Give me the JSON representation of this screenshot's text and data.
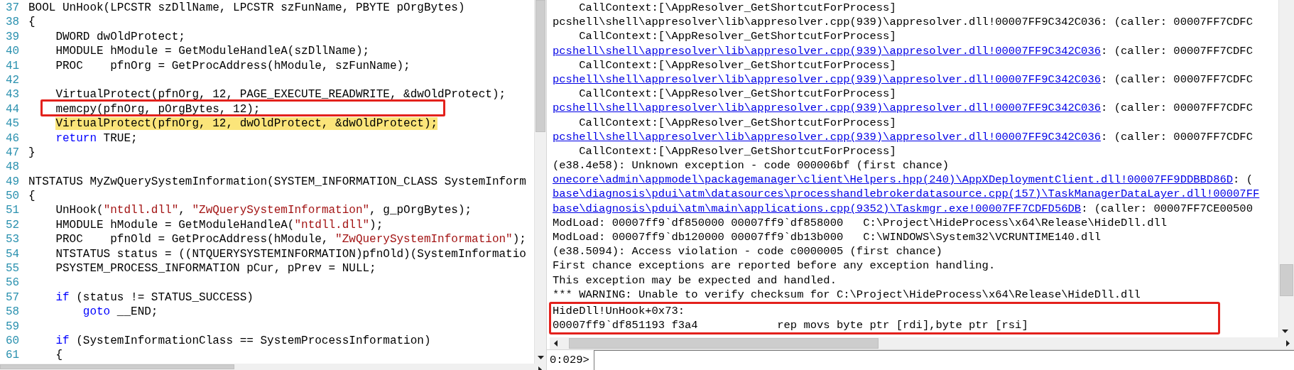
{
  "code_editor": {
    "lines": [
      {
        "number": "37",
        "highlighted": false,
        "boxed": false,
        "tokens": [
          {
            "kind": "plain",
            "text": "BOOL UnHook(LPCSTR szDllName, LPCSTR szFunName, PBYTE pOrgBytes)"
          }
        ]
      },
      {
        "number": "38",
        "highlighted": false,
        "boxed": false,
        "tokens": [
          {
            "kind": "plain",
            "text": "{"
          }
        ]
      },
      {
        "number": "39",
        "highlighted": false,
        "boxed": false,
        "tokens": [
          {
            "kind": "plain",
            "text": "    DWORD dwOldProtect;"
          }
        ]
      },
      {
        "number": "40",
        "highlighted": false,
        "boxed": false,
        "tokens": [
          {
            "kind": "plain",
            "text": "    HMODULE hModule = GetModuleHandleA(szDllName);"
          }
        ]
      },
      {
        "number": "41",
        "highlighted": false,
        "boxed": false,
        "tokens": [
          {
            "kind": "plain",
            "text": "    PROC    pfnOrg = GetProcAddress(hModule, szFunName);"
          }
        ]
      },
      {
        "number": "42",
        "highlighted": false,
        "boxed": false
      },
      {
        "number": "43",
        "highlighted": false,
        "boxed": false,
        "tokens": [
          {
            "kind": "plain",
            "text": "    VirtualProtect(pfnOrg, 12, PAGE_EXECUTE_READWRITE, &dwOldProtect);"
          }
        ]
      },
      {
        "number": "44",
        "highlighted": false,
        "boxed": true,
        "tokens": [
          {
            "kind": "plain",
            "text": "    memcpy(pfnOrg, pOrgBytes, 12);"
          }
        ]
      },
      {
        "number": "45",
        "highlighted": true,
        "boxed": false,
        "tokens": [
          {
            "kind": "plain",
            "text": "    VirtualProtect(pfnOrg, 12, dwOldProtect, &dwOldProtect);"
          }
        ]
      },
      {
        "number": "46",
        "highlighted": false,
        "boxed": false,
        "tokens": [
          {
            "kind": "keyword",
            "text": "    return"
          },
          {
            "kind": "plain",
            "text": " TRUE;"
          }
        ]
      },
      {
        "number": "47",
        "highlighted": false,
        "boxed": false,
        "tokens": [
          {
            "kind": "plain",
            "text": "}"
          }
        ]
      },
      {
        "number": "48",
        "highlighted": false,
        "boxed": false
      },
      {
        "number": "49",
        "highlighted": false,
        "boxed": false,
        "tokens": [
          {
            "kind": "plain",
            "text": "NTSTATUS MyZwQuerySystemInformation(SYSTEM_INFORMATION_CLASS SystemInform"
          }
        ]
      },
      {
        "number": "50",
        "highlighted": false,
        "boxed": false,
        "tokens": [
          {
            "kind": "plain",
            "text": "{"
          }
        ]
      },
      {
        "number": "51",
        "highlighted": false,
        "boxed": false,
        "tokens": [
          {
            "kind": "plain",
            "text": "    UnHook("
          },
          {
            "kind": "string",
            "text": "\"ntdll.dll\""
          },
          {
            "kind": "plain",
            "text": ", "
          },
          {
            "kind": "string",
            "text": "\"ZwQuerySystemInformation\""
          },
          {
            "kind": "plain",
            "text": ", g_pOrgBytes);"
          }
        ]
      },
      {
        "number": "52",
        "highlighted": false,
        "boxed": false,
        "tokens": [
          {
            "kind": "plain",
            "text": "    HMODULE hModule = GetModuleHandleA("
          },
          {
            "kind": "string",
            "text": "\"ntdll.dll\""
          },
          {
            "kind": "plain",
            "text": ");"
          }
        ]
      },
      {
        "number": "53",
        "highlighted": false,
        "boxed": false,
        "tokens": [
          {
            "kind": "plain",
            "text": "    PROC    pfnOld = GetProcAddress(hModule, "
          },
          {
            "kind": "string",
            "text": "\"ZwQuerySystemInformation\""
          },
          {
            "kind": "plain",
            "text": ");"
          }
        ]
      },
      {
        "number": "54",
        "highlighted": false,
        "boxed": false,
        "tokens": [
          {
            "kind": "plain",
            "text": "    NTSTATUS status = ((NTQUERYSYSTEMINFORMATION)pfnOld)(SystemInformatio"
          }
        ]
      },
      {
        "number": "55",
        "highlighted": false,
        "boxed": false,
        "tokens": [
          {
            "kind": "plain",
            "text": "    PSYSTEM_PROCESS_INFORMATION pCur, pPrev = NULL;"
          }
        ]
      },
      {
        "number": "56",
        "highlighted": false,
        "boxed": false
      },
      {
        "number": "57",
        "highlighted": false,
        "boxed": false,
        "tokens": [
          {
            "kind": "keyword",
            "text": "    if"
          },
          {
            "kind": "plain",
            "text": " (status != STATUS_SUCCESS)"
          }
        ]
      },
      {
        "number": "58",
        "highlighted": false,
        "boxed": false,
        "tokens": [
          {
            "kind": "keyword",
            "text": "        goto"
          },
          {
            "kind": "plain",
            "text": " __END;"
          }
        ]
      },
      {
        "number": "59",
        "highlighted": false,
        "boxed": false
      },
      {
        "number": "60",
        "highlighted": false,
        "boxed": false,
        "tokens": [
          {
            "kind": "keyword",
            "text": "    if"
          },
          {
            "kind": "plain",
            "text": " (SystemInformationClass == SystemProcessInformation)"
          }
        ]
      },
      {
        "number": "61",
        "highlighted": false,
        "boxed": false,
        "tokens": [
          {
            "kind": "plain",
            "text": "    {"
          }
        ]
      }
    ]
  },
  "debugger_output": {
    "lines": [
      {
        "boxed": false,
        "segments": [
          {
            "kind": "text",
            "text": "    CallContext:[\\AppResolver_GetShortcutForProcess]"
          }
        ]
      },
      {
        "boxed": false,
        "segments": [
          {
            "kind": "text",
            "text": "pcshell\\shell\\appresolver\\lib\\appresolver.cpp(939)\\appresolver.dll!00007FF9C342C036: (caller: 00007FF7CDFC"
          }
        ]
      },
      {
        "boxed": false,
        "segments": [
          {
            "kind": "text",
            "text": "    CallContext:[\\AppResolver_GetShortcutForProcess]"
          }
        ]
      },
      {
        "boxed": false,
        "segments": [
          {
            "kind": "link",
            "text": "pcshell\\shell\\appresolver\\lib\\appresolver.cpp(939)\\appresolver.dll!00007FF9C342C036"
          },
          {
            "kind": "text",
            "text": ": (caller: 00007FF7CDFC"
          }
        ]
      },
      {
        "boxed": false,
        "segments": [
          {
            "kind": "text",
            "text": "    CallContext:[\\AppResolver_GetShortcutForProcess]"
          }
        ]
      },
      {
        "boxed": false,
        "segments": [
          {
            "kind": "link",
            "text": "pcshell\\shell\\appresolver\\lib\\appresolver.cpp(939)\\appresolver.dll!00007FF9C342C036"
          },
          {
            "kind": "text",
            "text": ": (caller: 00007FF7CDFC"
          }
        ]
      },
      {
        "boxed": false,
        "segments": [
          {
            "kind": "text",
            "text": "    CallContext:[\\AppResolver_GetShortcutForProcess]"
          }
        ]
      },
      {
        "boxed": false,
        "segments": [
          {
            "kind": "link",
            "text": "pcshell\\shell\\appresolver\\lib\\appresolver.cpp(939)\\appresolver.dll!00007FF9C342C036"
          },
          {
            "kind": "text",
            "text": ": (caller: 00007FF7CDFC"
          }
        ]
      },
      {
        "boxed": false,
        "segments": [
          {
            "kind": "text",
            "text": "    CallContext:[\\AppResolver_GetShortcutForProcess]"
          }
        ]
      },
      {
        "boxed": false,
        "segments": [
          {
            "kind": "link",
            "text": "pcshell\\shell\\appresolver\\lib\\appresolver.cpp(939)\\appresolver.dll!00007FF9C342C036"
          },
          {
            "kind": "text",
            "text": ": (caller: 00007FF7CDFC"
          }
        ]
      },
      {
        "boxed": false,
        "segments": [
          {
            "kind": "text",
            "text": "    CallContext:[\\AppResolver_GetShortcutForProcess]"
          }
        ]
      },
      {
        "boxed": false,
        "segments": [
          {
            "kind": "text",
            "text": "(e38.4e58): Unknown exception - code 000006bf (first chance)"
          }
        ]
      },
      {
        "boxed": false,
        "segments": [
          {
            "kind": "link",
            "text": "onecore\\admin\\appmodel\\packagemanager\\client\\Helpers.hpp(240)\\AppXDeploymentClient.dll!00007FF9DDBBD86D"
          },
          {
            "kind": "text",
            "text": ": ("
          }
        ]
      },
      {
        "boxed": false,
        "segments": [
          {
            "kind": "link",
            "text": "base\\diagnosis\\pdui\\atm\\datasources\\processhandlebrokerdatasource.cpp(157)\\TaskManagerDataLayer.dll!00007FF"
          }
        ]
      },
      {
        "boxed": false,
        "segments": [
          {
            "kind": "link",
            "text": "base\\diagnosis\\pdui\\atm\\main\\applications.cpp(9352)\\Taskmgr.exe!00007FF7CDFD56DB"
          },
          {
            "kind": "text",
            "text": ": (caller: 00007FF7CE00500"
          }
        ]
      },
      {
        "boxed": false,
        "segments": [
          {
            "kind": "text",
            "text": "ModLoad: 00007ff9`df850000 00007ff9`df858000   C:\\Project\\HideProcess\\x64\\Release\\HideDll.dll"
          }
        ]
      },
      {
        "boxed": false,
        "segments": [
          {
            "kind": "text",
            "text": "ModLoad: 00007ff9`db120000 00007ff9`db13b000   C:\\WINDOWS\\System32\\VCRUNTIME140.dll"
          }
        ]
      },
      {
        "boxed": false,
        "segments": [
          {
            "kind": "text",
            "text": "(e38.5094): Access violation - code c0000005 (first chance)"
          }
        ]
      },
      {
        "boxed": false,
        "segments": [
          {
            "kind": "text",
            "text": "First chance exceptions are reported before any exception handling."
          }
        ]
      },
      {
        "boxed": false,
        "segments": [
          {
            "kind": "text",
            "text": "This exception may be expected and handled."
          }
        ]
      },
      {
        "boxed": false,
        "segments": [
          {
            "kind": "text",
            "text": "*** WARNING: Unable to verify checksum for C:\\Project\\HideProcess\\x64\\Release\\HideDll.dll"
          }
        ]
      },
      {
        "boxed": true,
        "segments": [
          {
            "kind": "text",
            "text": "HideDll!UnHook+0x73:"
          }
        ]
      },
      {
        "boxed": true,
        "segments": [
          {
            "kind": "text",
            "text": "00007ff9`df851193 f3a4            rep movs byte ptr [rdi],byte ptr [rsi]"
          }
        ]
      }
    ],
    "command_prompt": "0:029>"
  }
}
